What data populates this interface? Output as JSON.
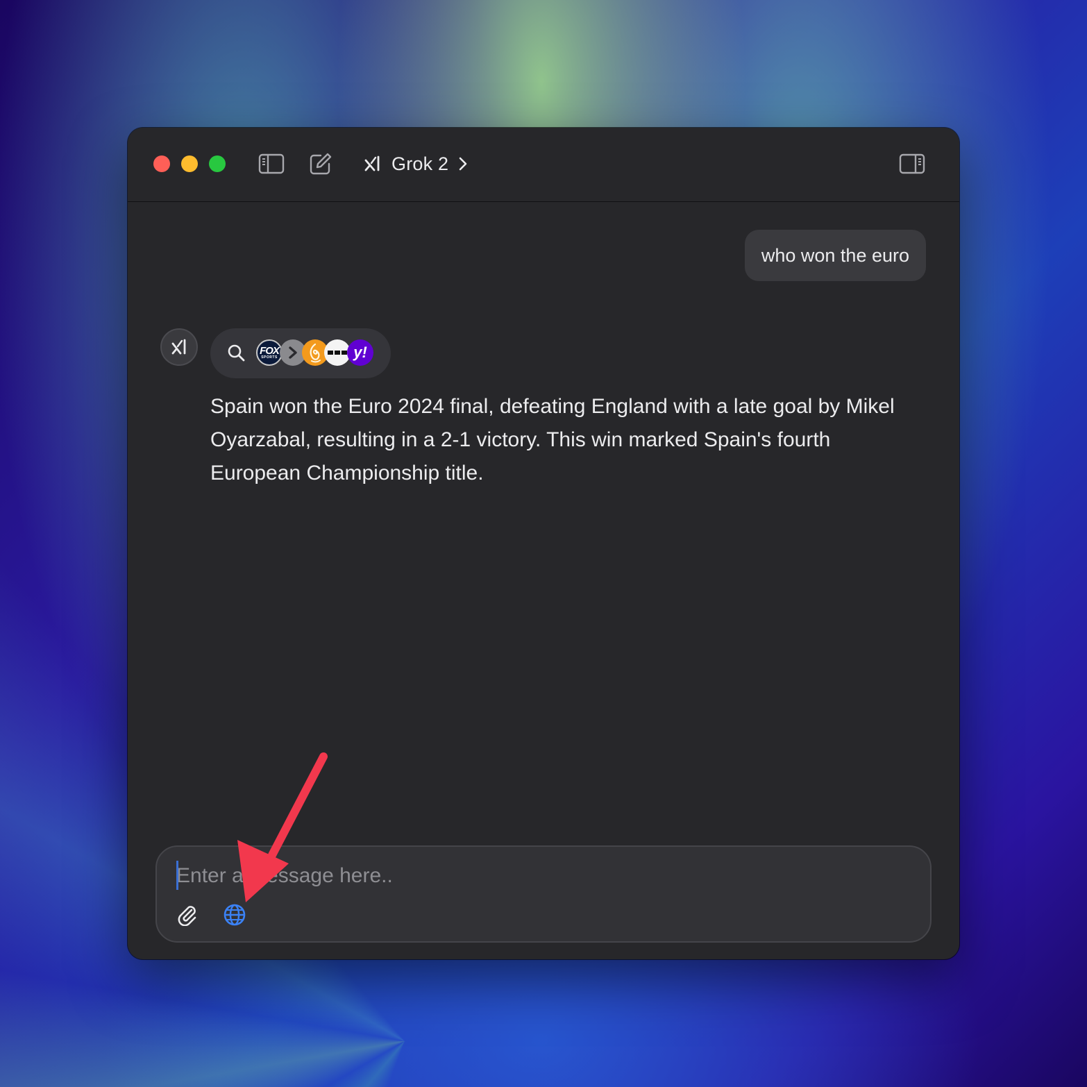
{
  "window": {
    "model_name": "Grok 2",
    "icons": {
      "sidebar_toggle": "sidebar-left-icon",
      "compose": "new-chat-icon",
      "model_logo": "xai-logo-icon",
      "model_chevron": "chevron-right-icon",
      "inspector_toggle": "sidebar-right-icon"
    }
  },
  "conversation": {
    "user_message": "who won the euro",
    "assistant": {
      "avatar_icon": "xai-logo-icon",
      "sources": [
        {
          "name": "fox-sports",
          "label": "FOX",
          "sublabel": "SPORTS"
        },
        {
          "name": "chevron-source",
          "label": "›"
        },
        {
          "name": "al-jazeera",
          "label": ""
        },
        {
          "name": "dots-source",
          "label": ""
        },
        {
          "name": "yahoo",
          "label": "y!"
        }
      ],
      "answer": "Spain won the Euro 2024 final, defeating England with a late goal by Mikel Oyarzabal, resulting in a 2-1 victory. This win marked Spain's fourth European Championship title."
    }
  },
  "composer": {
    "placeholder": "Enter a message here..",
    "value": "",
    "attach_icon": "paperclip-icon",
    "web_search_icon": "globe-icon",
    "web_search_color": "#3b82f6"
  },
  "colors": {
    "window_bg": "#27272a",
    "bubble_bg": "#3a3a3e",
    "accent_blue": "#3b82f6",
    "annotation_red": "#f2384d"
  }
}
